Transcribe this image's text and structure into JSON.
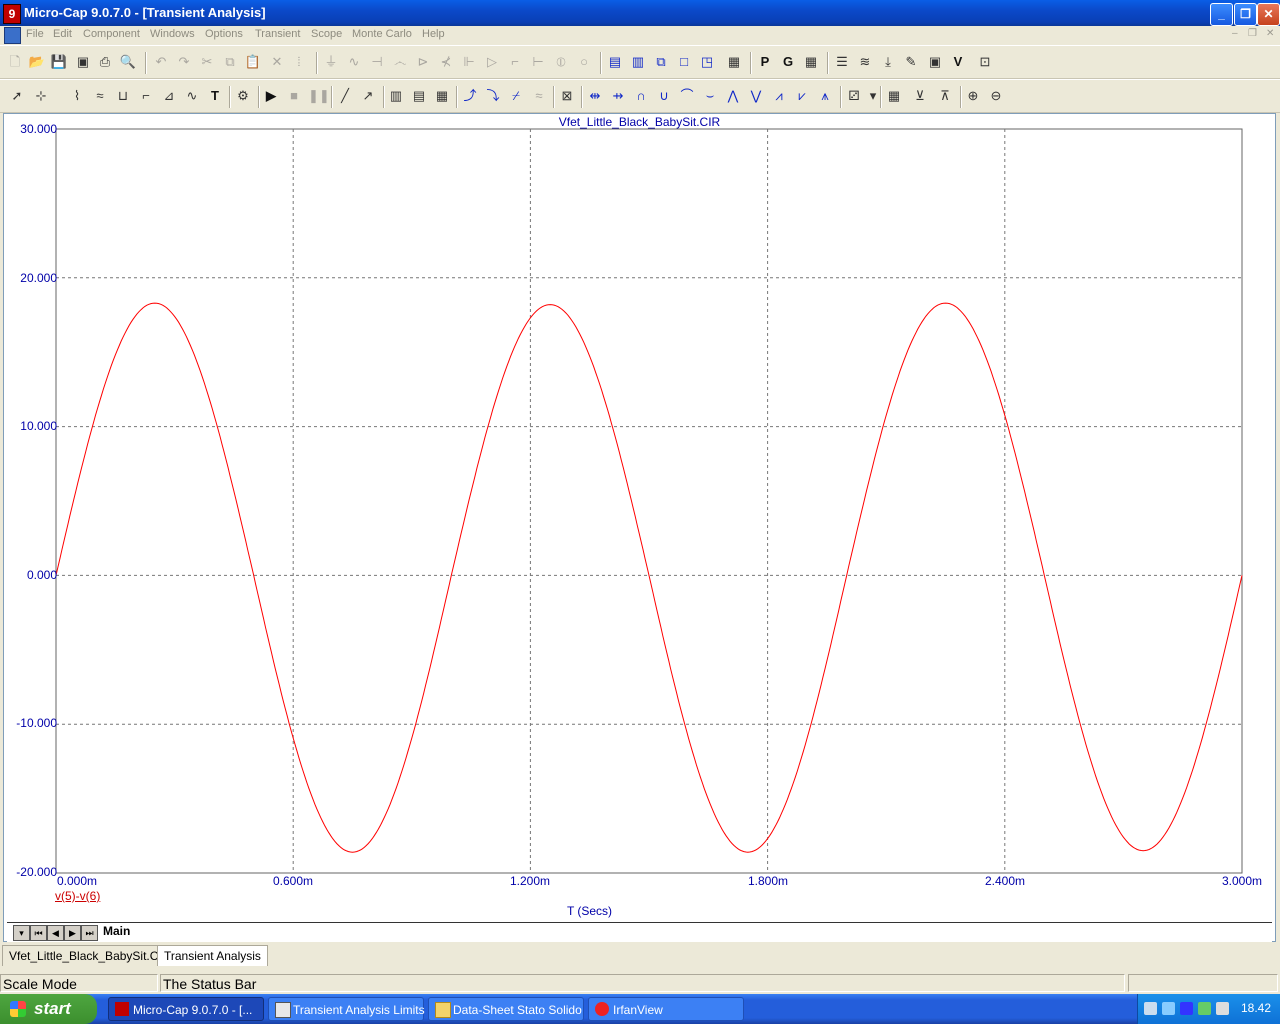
{
  "window": {
    "title": "Micro-Cap 9.0.7.0 - [Transient Analysis]",
    "controls": [
      "minimize",
      "restore",
      "close"
    ]
  },
  "menu": {
    "items": [
      "File",
      "Edit",
      "Component",
      "Windows",
      "Options",
      "Transient",
      "Scope",
      "Monte Carlo",
      "Help"
    ]
  },
  "plot": {
    "title": "Vfet_Little_Black_BabySit.CIR",
    "legend": "v(5)-v(6)",
    "xlabel": "T (Secs)",
    "yticks": [
      "30.000",
      "20.000",
      "10.000",
      "0.000",
      "-10.000",
      "-20.000"
    ],
    "xticks": [
      "0.000m",
      "0.600m",
      "1.200m",
      "1.800m",
      "2.400m",
      "3.000m"
    ],
    "trace_color": "#ff0000"
  },
  "chart_data": {
    "type": "line",
    "title": "Vfet_Little_Black_BabySit.CIR",
    "xlabel": "T (Secs)",
    "ylabel": "",
    "xlim": [
      0,
      3.0
    ],
    "ylim": [
      -20,
      30
    ],
    "x_unit": "m",
    "grid": true,
    "series": [
      {
        "name": "v(5)-v(6)",
        "color": "#ff0000",
        "x": [
          0,
          0.25,
          0.5,
          0.75,
          1.0,
          1.25,
          1.5,
          1.75,
          2.0,
          2.25,
          2.5,
          2.75,
          3.0
        ],
        "y": [
          0,
          18.3,
          0,
          -18.6,
          0,
          18.2,
          0,
          -18.6,
          0,
          18.3,
          0,
          -18.5,
          0
        ]
      }
    ]
  },
  "nav": {
    "sheet_tab": "Main"
  },
  "doc_tabs": [
    "Vfet_Little_Black_BabySit.CIR",
    "Transient Analysis"
  ],
  "status": {
    "mode": "Scale Mode",
    "message": "The Status Bar"
  },
  "taskbar": {
    "start": "start",
    "tasks": [
      "Micro-Cap 9.0.7.0 - [...",
      "Transient Analysis Limits",
      "Data-Sheet Stato Solido",
      "IrfanView"
    ],
    "clock": "18.42"
  }
}
